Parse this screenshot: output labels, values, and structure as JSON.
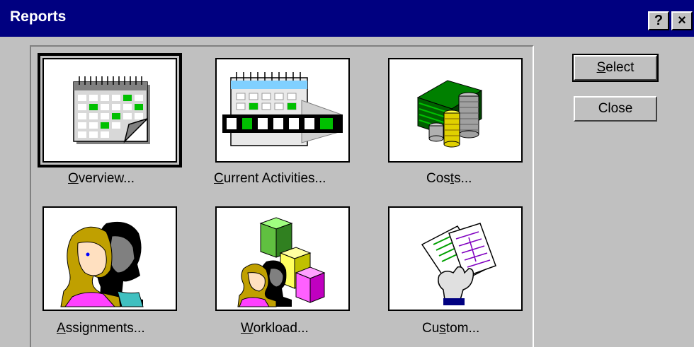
{
  "window": {
    "title": "Reports",
    "help_glyph": "?",
    "close_glyph": "×"
  },
  "reports": [
    {
      "key": "overview",
      "pre": "",
      "accel": "O",
      "post": "verview...",
      "icon": "calendar-icon",
      "selected": true
    },
    {
      "key": "current-activities",
      "pre": "",
      "accel": "C",
      "post": "urrent Activities...",
      "icon": "gantt-calendar-icon",
      "selected": false
    },
    {
      "key": "costs",
      "pre": "Cos",
      "accel": "t",
      "post": "s...",
      "icon": "money-coins-icon",
      "selected": false
    },
    {
      "key": "assignments",
      "pre": "",
      "accel": "A",
      "post": "ssignments...",
      "icon": "people-icon",
      "selected": false
    },
    {
      "key": "workload",
      "pre": "",
      "accel": "W",
      "post": "orkload...",
      "icon": "workload-blocks-icon",
      "selected": false
    },
    {
      "key": "custom",
      "pre": "Cu",
      "accel": "s",
      "post": "tom...",
      "icon": "hand-documents-icon",
      "selected": false
    }
  ],
  "buttons": {
    "select": {
      "accel": "S",
      "rest": "elect"
    },
    "close": {
      "label": "Close"
    }
  },
  "colors": {
    "titlebar": "#000080",
    "face": "#c0c0c0",
    "green": "#00c000",
    "teal": "#008080"
  }
}
